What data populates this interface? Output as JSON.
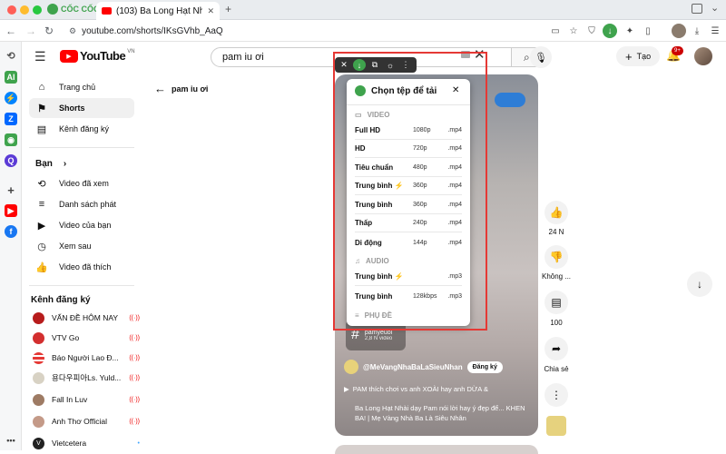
{
  "browser": {
    "brand": "CỐC CỐC",
    "tab_title": "(103) Ba Long Hạt Nhài dạy",
    "url": "youtube.com/shorts/IKsGVhb_AaQ",
    "notification_count": "9+"
  },
  "youtube": {
    "logo_text": "YouTube",
    "logo_region": "VN",
    "search_value": "pam iu ơi",
    "create_label": "Tạo",
    "back_label": "pam iu ơi"
  },
  "sidebar": {
    "main": [
      {
        "label": "Trang chủ",
        "icon": "home-icon"
      },
      {
        "label": "Shorts",
        "icon": "shorts-icon"
      },
      {
        "label": "Kênh đăng ký",
        "icon": "subscriptions-icon"
      }
    ],
    "you_header": "Bạn",
    "you_items": [
      {
        "label": "Video đã xem"
      },
      {
        "label": "Danh sách phát"
      },
      {
        "label": "Video của bạn"
      },
      {
        "label": "Xem sau"
      },
      {
        "label": "Video đã thích"
      }
    ],
    "subs_header": "Kênh đăng ký",
    "subs": [
      {
        "label": "VẤN ĐỀ HÔM NAY",
        "live": "((·))"
      },
      {
        "label": "VTV Go",
        "live": "((·))"
      },
      {
        "label": "Báo Người Lao Đ...",
        "live": "((·))"
      },
      {
        "label": "용다우피아Ls. Yuld...",
        "live": "((·))"
      },
      {
        "label": "Fall In Luv",
        "live": "((·))"
      },
      {
        "label": "Anh Thơ Official",
        "live": "((·))"
      },
      {
        "label": "Vietcetera",
        "live": "•"
      }
    ]
  },
  "short": {
    "hashtag_name": "pamyeuoi",
    "hashtag_count": "2,8 N video",
    "channel": "@MeVangNhaBaLaSieuNhan",
    "subscribe_label": "Đăng ký",
    "music_line": "PAM thích chơi vs anh XOÀI hay anh DỪA &",
    "description": "Ba Long Hạt Nhài dạy Pam nói lời hay ý đẹp để... KHEN BA! | Mẹ Vàng Nhà Ba Là Siêu Nhân",
    "like_count": "24 N",
    "dislike_label": "Không ...",
    "comment_count": "100",
    "share_label": "Chia sẻ"
  },
  "downloader": {
    "title": "Chọn tệp để tải",
    "video_header": "VIDEO",
    "audio_header": "AUDIO",
    "subtitle_header": "PHỤ ĐỀ",
    "video_rows": [
      {
        "name": "Full HD",
        "quality": "1080p",
        "format": ".mp4"
      },
      {
        "name": "HD",
        "quality": "720p",
        "format": ".mp4"
      },
      {
        "name": "Tiêu chuẩn",
        "quality": "480p",
        "format": ".mp4"
      },
      {
        "name": "Trung bình",
        "quality": "360p",
        "format": ".mp4",
        "bolt": "⚡"
      },
      {
        "name": "Trung bình",
        "quality": "360p",
        "format": ".mp4"
      },
      {
        "name": "Thấp",
        "quality": "240p",
        "format": ".mp4"
      },
      {
        "name": "Di động",
        "quality": "144p",
        "format": ".mp4"
      }
    ],
    "audio_rows": [
      {
        "name": "Trung bình",
        "quality": "",
        "format": ".mp3",
        "bolt": "⚡"
      },
      {
        "name": "Trung bình",
        "quality": "128kbps",
        "format": ".mp3"
      }
    ]
  },
  "colors": {
    "youtube_red": "#ff0000",
    "coccoc_green": "#3fa34d",
    "highlight_red": "#e53935"
  }
}
